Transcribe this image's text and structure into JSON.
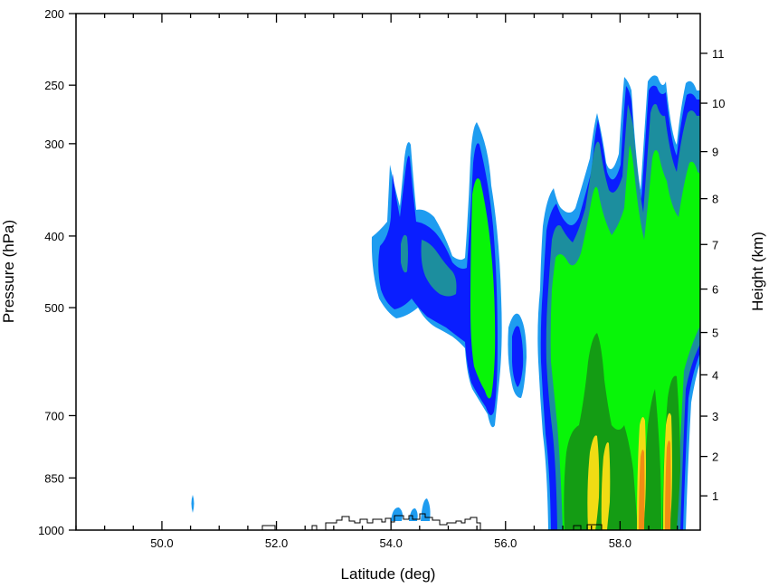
{
  "chart_data": {
    "type": "contour",
    "xlabel": "Latitude (deg)",
    "ylabel_left": "Pressure (hPa)",
    "ylabel_right": "Height (km)",
    "xlim": [
      48.5,
      59.4
    ],
    "x_ticks": [
      50.0,
      52.0,
      54.0,
      56.0,
      58.0
    ],
    "x_tick_labels": [
      "50.0",
      "52.0",
      "54.0",
      "56.0",
      "58.0"
    ],
    "p_range": [
      1000,
      200
    ],
    "p_scale": "log",
    "p_ticks": [
      200,
      250,
      300,
      400,
      500,
      700,
      850,
      1000
    ],
    "p_tick_labels": [
      "200",
      "250",
      "300",
      "400",
      "500",
      "700",
      "850",
      "1000"
    ],
    "height_ticks_km": [
      1,
      2,
      3,
      4,
      5,
      6,
      7,
      8,
      9,
      10,
      11
    ],
    "height_tick_labels": [
      "1",
      "2",
      "3",
      "4",
      "5",
      "6",
      "7",
      "8",
      "9",
      "10",
      "11"
    ],
    "contour_colors": [
      "#1e9cf0",
      "#0a1eff",
      "#1c8e9e",
      "#08f508",
      "#149c14",
      "#f0dc14",
      "#f08c14",
      "#c85000"
    ],
    "terrain_outline_color": "#000000"
  }
}
